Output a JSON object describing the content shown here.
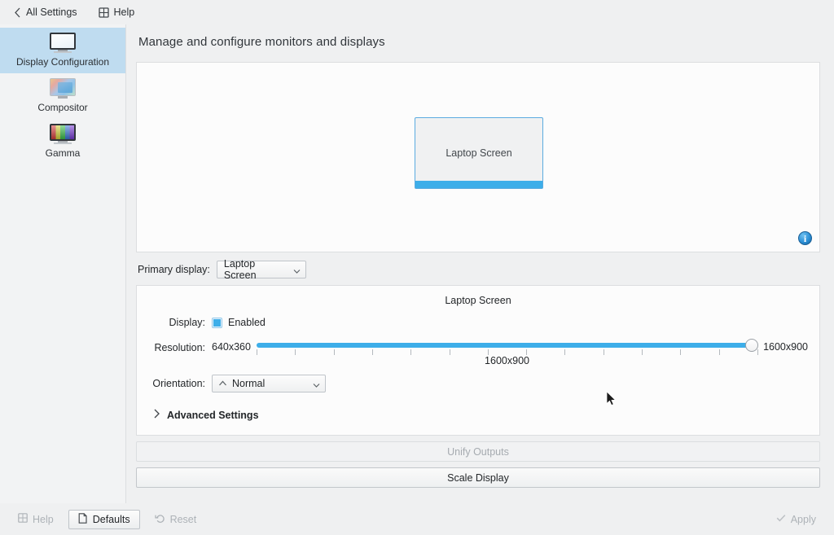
{
  "toolbar": {
    "back_label": "All Settings",
    "back_icon": "chevron-left-icon",
    "help_label": "Help",
    "help_icon": "window-grid-icon"
  },
  "sidebar": {
    "items": [
      {
        "label": "Display Configuration",
        "icon": "monitor-icon",
        "selected": true
      },
      {
        "label": "Compositor",
        "icon": "compositor-icon",
        "selected": false
      },
      {
        "label": "Gamma",
        "icon": "gamma-icon",
        "selected": false
      }
    ]
  },
  "page": {
    "title": "Manage and configure monitors and displays"
  },
  "preview": {
    "monitor_label": "Laptop Screen",
    "info_icon": "info-icon",
    "info_glyph": "i",
    "accent_color": "#3daee9"
  },
  "primary_display": {
    "label": "Primary display:",
    "value": "Laptop Screen",
    "options": [
      "Laptop Screen"
    ],
    "chevron_icon": "chevron-down-icon"
  },
  "output": {
    "title": "Laptop Screen",
    "display_label": "Display:",
    "enabled_label": "Enabled",
    "enabled_checked": true,
    "resolution_label": "Resolution:",
    "resolution_min": "640x360",
    "resolution_max": "1600x900",
    "resolution_current": "1600x900",
    "resolution_tick_count": 14,
    "orientation_label": "Orientation:",
    "orientation_value": "Normal",
    "orientation_icon": "arrow-up-icon",
    "orientation_options": [
      "Normal"
    ],
    "advanced_label": "Advanced Settings",
    "advanced_icon": "chevron-right-icon"
  },
  "actions": {
    "unify_label": "Unify Outputs",
    "unify_enabled": false,
    "scale_label": "Scale Display",
    "scale_enabled": true
  },
  "footer": {
    "help_label": "Help",
    "help_icon": "help-grid-icon",
    "help_enabled": false,
    "defaults_label": "Defaults",
    "defaults_icon": "document-icon",
    "defaults_enabled": true,
    "reset_label": "Reset",
    "reset_icon": "undo-icon",
    "reset_enabled": false,
    "apply_label": "Apply",
    "apply_icon": "check-icon",
    "apply_enabled": false
  }
}
